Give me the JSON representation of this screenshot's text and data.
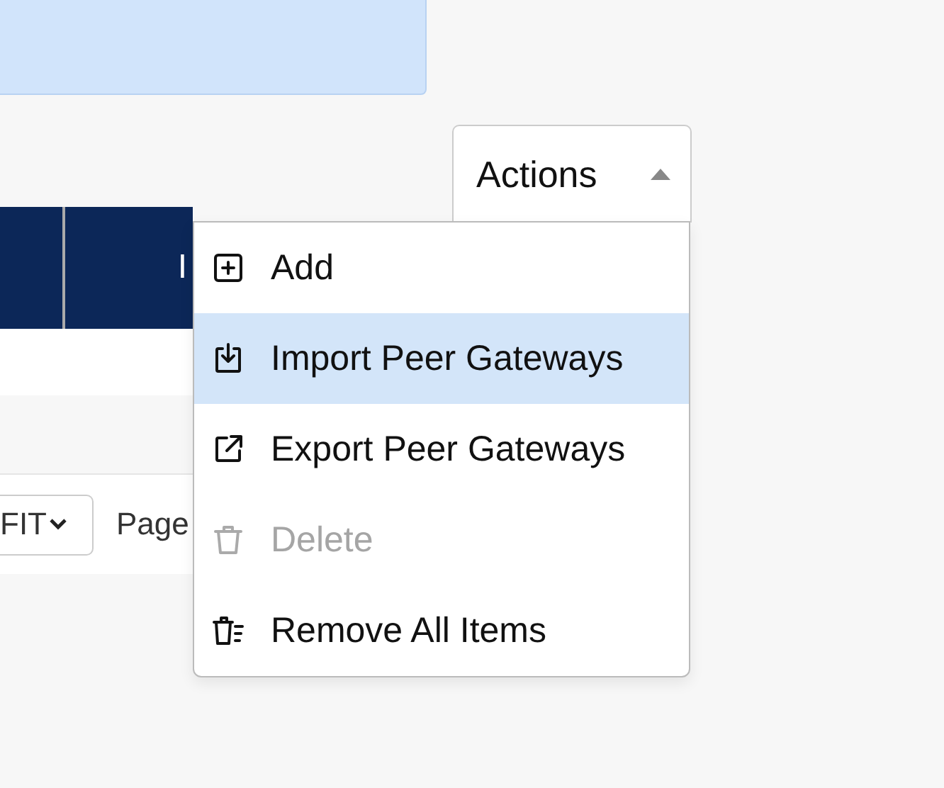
{
  "actions_button": {
    "label": "Actions",
    "expanded": true
  },
  "table": {
    "column_2": {
      "label": "I"
    }
  },
  "footer": {
    "page_size": "FIT",
    "page_label": "Page"
  },
  "menu": [
    {
      "label": "Add",
      "kind": "add",
      "selected": false,
      "disabled": false
    },
    {
      "label": "Import Peer Gateways",
      "kind": "import",
      "selected": true,
      "disabled": false
    },
    {
      "label": "Export Peer Gateways",
      "kind": "export",
      "selected": false,
      "disabled": false
    },
    {
      "label": "Delete",
      "kind": "delete",
      "selected": false,
      "disabled": true
    },
    {
      "label": "Remove All Items",
      "kind": "remove",
      "selected": false,
      "disabled": false
    }
  ]
}
